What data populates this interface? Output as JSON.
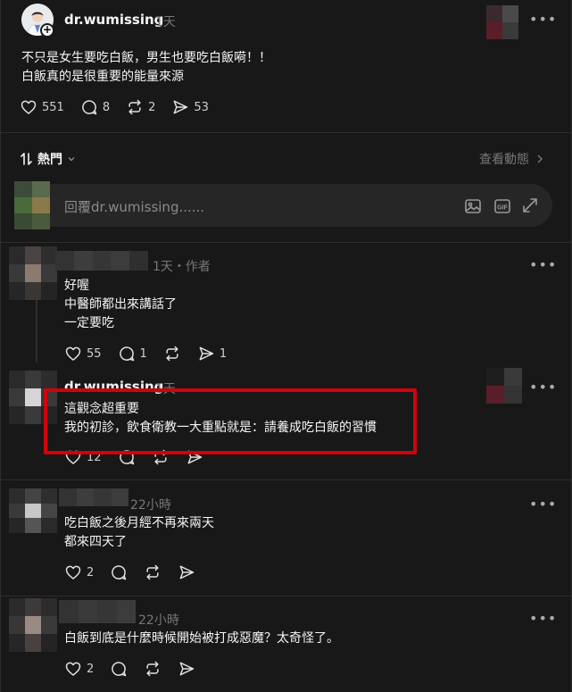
{
  "post": {
    "author": "dr.wumissing",
    "time": "1天",
    "lines": [
      "不只是女生要吃白飯，男生也要吃白飯嗬！！",
      "白飯真的是很重要的能量來源"
    ],
    "likes": "551",
    "comments": "8",
    "reposts": "2",
    "shares": "53"
  },
  "sort": {
    "label": "熱門",
    "view_activity": "查看動態"
  },
  "reply_box": {
    "placeholder": "回覆dr.wumissing......"
  },
  "comments": [
    {
      "author": "",
      "time": "1天・作者",
      "lines": [
        "好喔",
        "中醫師都出來講話了",
        "一定要吃"
      ],
      "likes": "55",
      "comments": "1",
      "reposts": "",
      "shares": "1"
    },
    {
      "author": "dr.wumissing",
      "time": "1天",
      "lines": [
        "這觀念超重要",
        "我的初診，飲食衛教一大重點就是：請養成吃白飯的習慣"
      ],
      "likes": "12",
      "comments": "",
      "reposts": "",
      "shares": ""
    },
    {
      "author": "",
      "time": "22小時",
      "lines": [
        "吃白飯之後月經不再來兩天",
        "都來四天了"
      ],
      "likes": "2",
      "comments": "",
      "reposts": "",
      "shares": ""
    },
    {
      "author": "",
      "time": "22小時",
      "lines": [
        "白飯到底是什麼時候開始被打成惡魔？太奇怪了。"
      ],
      "likes": "2",
      "comments": "",
      "reposts": "",
      "shares": ""
    }
  ],
  "colors": {
    "background": "#181818",
    "highlight": "#d0020c"
  }
}
